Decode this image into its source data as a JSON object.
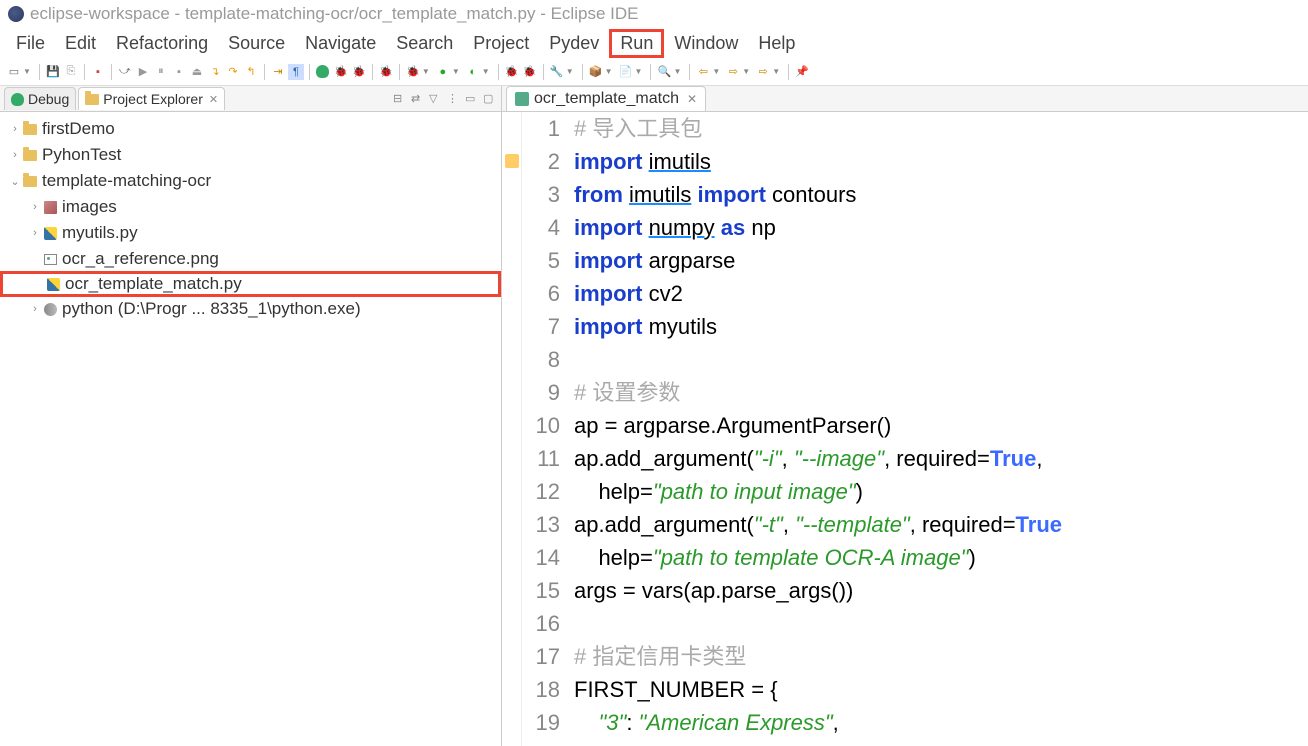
{
  "title": "eclipse-workspace - template-matching-ocr/ocr_template_match.py - Eclipse IDE",
  "menubar": [
    "File",
    "Edit",
    "Refactoring",
    "Source",
    "Navigate",
    "Search",
    "Project",
    "Pydev",
    "Run",
    "Window",
    "Help"
  ],
  "highlighted_menu": "Run",
  "views": {
    "debug": {
      "label": "Debug"
    },
    "project_explorer": {
      "label": "Project Explorer"
    }
  },
  "tree": {
    "items": [
      {
        "type": "proj",
        "expand": "closed",
        "indent": 0,
        "label": "firstDemo"
      },
      {
        "type": "proj",
        "expand": "closed",
        "indent": 0,
        "label": "PyhonTest"
      },
      {
        "type": "proj",
        "expand": "open",
        "indent": 0,
        "label": "template-matching-ocr"
      },
      {
        "type": "pkg",
        "expand": "closed",
        "indent": 1,
        "label": "images"
      },
      {
        "type": "py",
        "expand": "closed",
        "indent": 1,
        "label": "myutils.py"
      },
      {
        "type": "img",
        "expand": "none",
        "indent": 1,
        "label": "ocr_a_reference.png"
      },
      {
        "type": "py",
        "expand": "none",
        "indent": 1,
        "label": "ocr_template_match.py",
        "highlighted": true
      },
      {
        "type": "snake",
        "expand": "closed",
        "indent": 1,
        "label": "python  (D:\\Progr ... 8335_1\\python.exe)"
      }
    ]
  },
  "editor_tab": {
    "label": "ocr_template_match"
  },
  "code": {
    "lines": [
      {
        "n": 1,
        "tokens": [
          {
            "c": "cm",
            "t": "# 导入工具包"
          }
        ]
      },
      {
        "n": 2,
        "tokens": [
          {
            "c": "kw",
            "t": "import "
          },
          {
            "c": "mod",
            "t": "imutils"
          }
        ]
      },
      {
        "n": 3,
        "tokens": [
          {
            "c": "kw",
            "t": "from "
          },
          {
            "c": "mod",
            "t": "imutils"
          },
          {
            "c": "plain",
            "t": " "
          },
          {
            "c": "kw",
            "t": "import"
          },
          {
            "c": "plain",
            "t": " contours"
          }
        ]
      },
      {
        "n": 4,
        "tokens": [
          {
            "c": "kw",
            "t": "import "
          },
          {
            "c": "mod",
            "t": "numpy"
          },
          {
            "c": "plain",
            "t": " "
          },
          {
            "c": "kw",
            "t": "as"
          },
          {
            "c": "plain",
            "t": " np"
          }
        ]
      },
      {
        "n": 5,
        "tokens": [
          {
            "c": "kw",
            "t": "import "
          },
          {
            "c": "plain",
            "t": "argparse"
          }
        ]
      },
      {
        "n": 6,
        "tokens": [
          {
            "c": "kw",
            "t": "import "
          },
          {
            "c": "plain",
            "t": "cv2"
          }
        ]
      },
      {
        "n": 7,
        "tokens": [
          {
            "c": "kw",
            "t": "import "
          },
          {
            "c": "plain",
            "t": "myutils"
          }
        ]
      },
      {
        "n": 8,
        "tokens": []
      },
      {
        "n": 9,
        "tokens": [
          {
            "c": "cm",
            "t": "# 设置参数"
          }
        ]
      },
      {
        "n": 10,
        "tokens": [
          {
            "c": "plain",
            "t": "ap = argparse.ArgumentParser()"
          }
        ]
      },
      {
        "n": 11,
        "tokens": [
          {
            "c": "plain",
            "t": "ap.add_argument("
          },
          {
            "c": "st",
            "t": "\"-i\""
          },
          {
            "c": "plain",
            "t": ", "
          },
          {
            "c": "st",
            "t": "\"--image\""
          },
          {
            "c": "plain",
            "t": ", required="
          },
          {
            "c": "cn",
            "t": "True"
          },
          {
            "c": "plain",
            "t": ","
          }
        ]
      },
      {
        "n": 12,
        "tokens": [
          {
            "c": "plain",
            "t": "    help="
          },
          {
            "c": "st",
            "t": "\"path to input image\""
          },
          {
            "c": "plain",
            "t": ")"
          }
        ]
      },
      {
        "n": 13,
        "tokens": [
          {
            "c": "plain",
            "t": "ap.add_argument("
          },
          {
            "c": "st",
            "t": "\"-t\""
          },
          {
            "c": "plain",
            "t": ", "
          },
          {
            "c": "st",
            "t": "\"--template\""
          },
          {
            "c": "plain",
            "t": ", required="
          },
          {
            "c": "cn",
            "t": "True"
          }
        ]
      },
      {
        "n": 14,
        "tokens": [
          {
            "c": "plain",
            "t": "    help="
          },
          {
            "c": "st",
            "t": "\"path to template OCR-A image\""
          },
          {
            "c": "plain",
            "t": ")"
          }
        ]
      },
      {
        "n": 15,
        "tokens": [
          {
            "c": "plain",
            "t": "args = vars(ap.parse_args())"
          }
        ]
      },
      {
        "n": 16,
        "tokens": []
      },
      {
        "n": 17,
        "tokens": [
          {
            "c": "cm",
            "t": "# 指定信用卡类型"
          }
        ]
      },
      {
        "n": 18,
        "tokens": [
          {
            "c": "plain",
            "t": "FIRST_NUMBER = {"
          }
        ]
      },
      {
        "n": 19,
        "tokens": [
          {
            "c": "plain",
            "t": "    "
          },
          {
            "c": "st",
            "t": "\"3\""
          },
          {
            "c": "plain",
            "t": ": "
          },
          {
            "c": "st",
            "t": "\"American Express\""
          },
          {
            "c": "plain",
            "t": ","
          }
        ]
      }
    ]
  }
}
